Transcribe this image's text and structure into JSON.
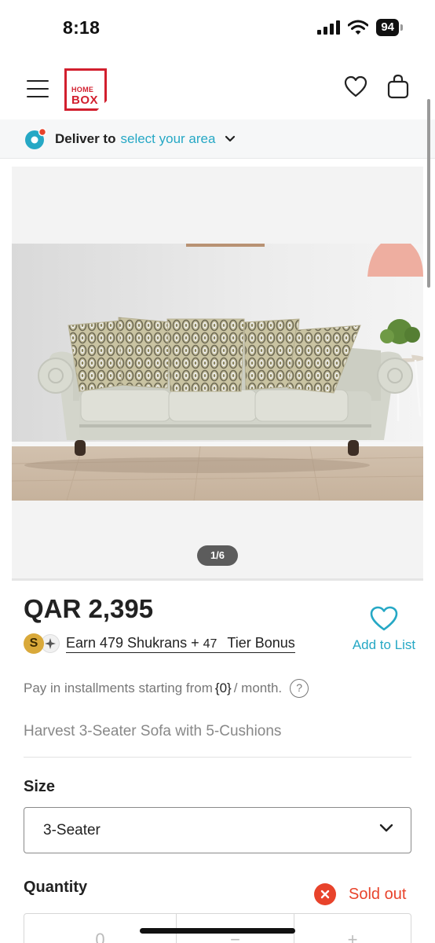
{
  "status_bar": {
    "time": "8:18",
    "battery": "94"
  },
  "header": {
    "logo_line1": "HOME",
    "logo_line2": "BOX",
    "brand_color": "#d21f2e"
  },
  "deliver": {
    "label": "Deliver to",
    "link": "select your area",
    "link_color": "#26a8c5"
  },
  "gallery": {
    "counter": "1/6"
  },
  "product": {
    "price": "QAR 2,395",
    "shukran_coin": "S",
    "shukran_earn": "Earn 479 Shukrans +",
    "tier_bonus_value": "47",
    "tier_bonus_label": "Tier Bonus",
    "add_to_list": "Add to List",
    "installments_prefix": "Pay in installments starting from",
    "installments_value": "{0}",
    "installments_suffix": "/ month.",
    "installments_help": "?",
    "name": "Harvest 3-Seater Sofa with 5-Cushions"
  },
  "size": {
    "label": "Size",
    "selected": "3-Seater"
  },
  "quantity": {
    "label": "Quantity",
    "status": "Sold out",
    "status_color": "#e8432b",
    "value": "0",
    "decrement": "−",
    "increment": "+"
  }
}
